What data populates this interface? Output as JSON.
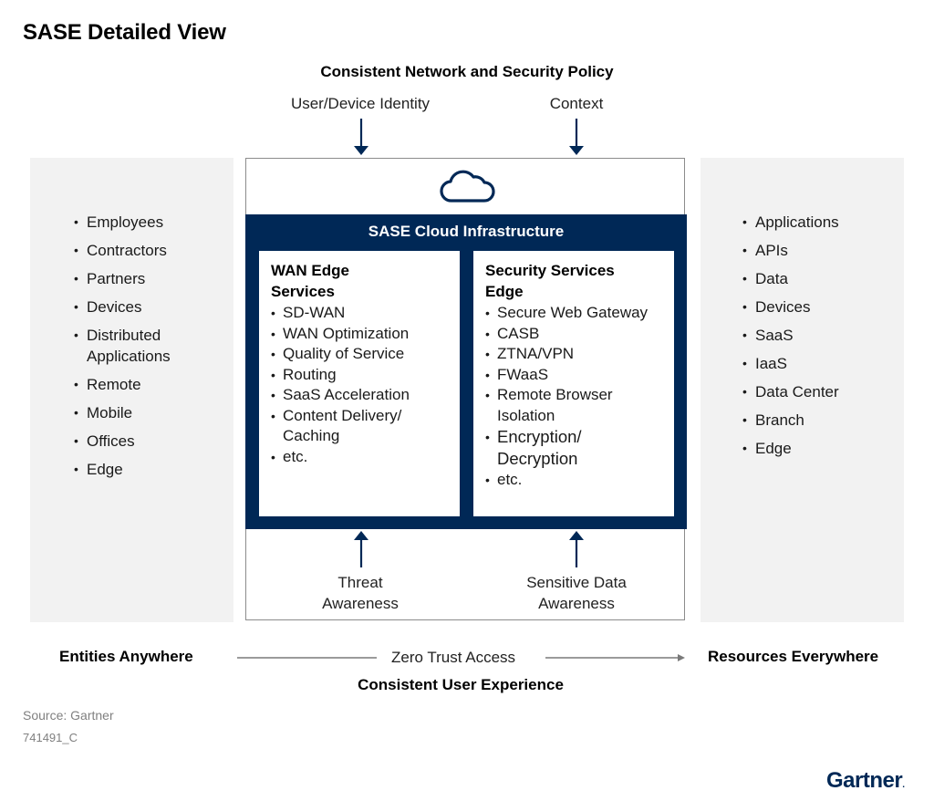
{
  "title": "SASE Detailed View",
  "policy_header": "Consistent Network and Security Policy",
  "top_inputs": [
    {
      "label": "User/Device Identity"
    },
    {
      "label": "Context"
    }
  ],
  "left_panel": {
    "items": [
      "Employees",
      "Contractors",
      "Partners",
      "Devices",
      "Distributed Applications",
      "Remote",
      "Mobile",
      "Offices",
      "Edge"
    ]
  },
  "right_panel": {
    "items": [
      "Applications",
      "APIs",
      "Data",
      "Devices",
      "SaaS",
      "IaaS",
      "Data Center",
      "Branch",
      "Edge"
    ]
  },
  "center": {
    "icon": "cloud-icon",
    "infrastructure_title": "SASE Cloud Infrastructure",
    "wan_edge": {
      "heading": "WAN Edge Services",
      "items": [
        "SD-WAN",
        "WAN Optimization",
        "Quality of Service",
        "Routing",
        "SaaS Acceleration",
        "Content Delivery/ Caching",
        "etc."
      ]
    },
    "sse": {
      "heading": "Security Services Edge",
      "items": [
        "Secure Web Gateway",
        "CASB",
        "ZTNA/VPN",
        "FWaaS",
        "Remote Browser Isolation",
        "Encryption/ Decryption",
        "etc."
      ]
    }
  },
  "bottom_inputs": [
    {
      "label": "Threat Awareness"
    },
    {
      "label": "Sensitive Data Awareness"
    }
  ],
  "flow": {
    "left": "Entities Anywhere",
    "middle": "Zero Trust Access",
    "right": "Resources Everywhere",
    "subtitle": "Consistent User Experience"
  },
  "source": "Source: Gartner",
  "figure_id": "741491_C",
  "logo": "Gartner",
  "colors": {
    "navy": "#002856",
    "panel_gray": "#f2f2f2",
    "border_gray": "#8c8c8c",
    "muted_text": "#808080"
  }
}
